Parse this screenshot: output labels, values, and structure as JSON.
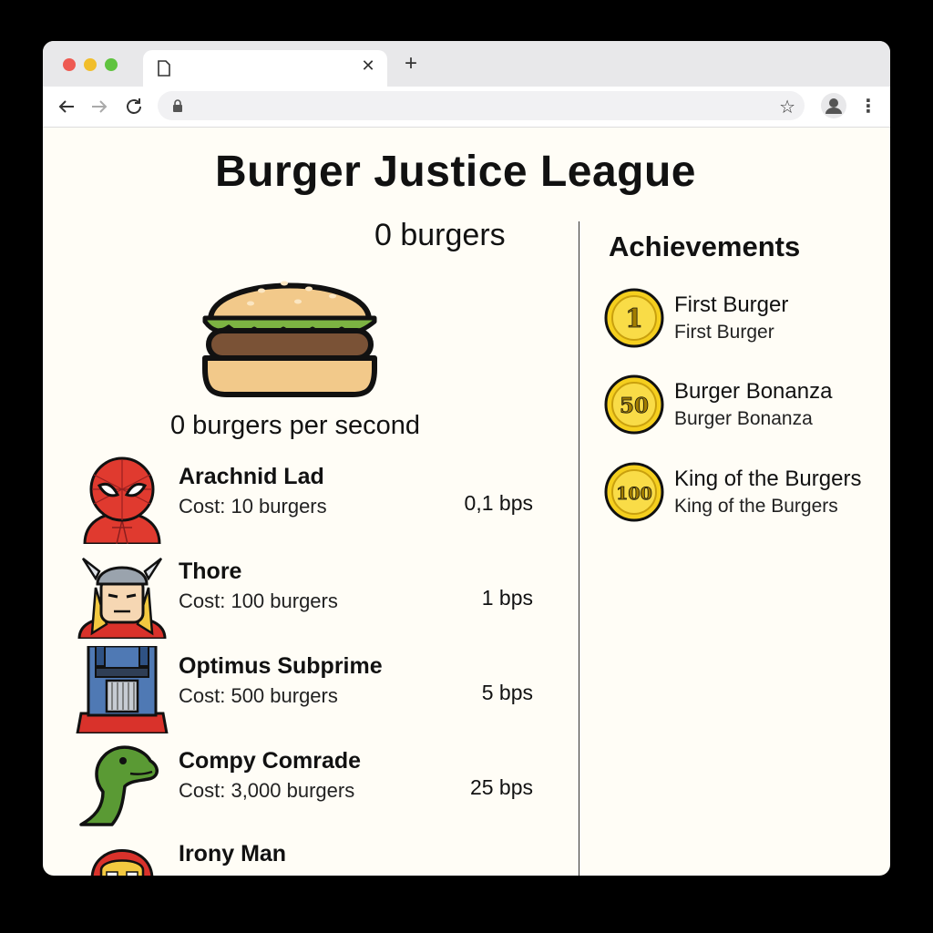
{
  "page": {
    "title": "Burger Justice League",
    "burger_count": "0 burgers",
    "burgers_per_second": "0 burgers per second"
  },
  "heroes": [
    {
      "name": "Arachnid Lad",
      "cost": "Cost: 10 burgers",
      "rate": "0,1 bps",
      "icon": "spider-hero-icon"
    },
    {
      "name": "Thore",
      "cost": "Cost: 100 burgers",
      "rate": "1 bps",
      "icon": "thunder-god-hero-icon"
    },
    {
      "name": "Optimus Subprime",
      "cost": "Cost: 500 burgers",
      "rate": "5 bps",
      "icon": "robot-hero-icon"
    },
    {
      "name": "Compy Comrade",
      "cost": "Cost: 3,000 burgers",
      "rate": "25 bps",
      "icon": "dinosaur-hero-icon"
    },
    {
      "name": "Irony Man",
      "icon": "armor-hero-icon"
    }
  ],
  "achievements": {
    "title": "Achievements",
    "items": [
      {
        "name": "First Burger",
        "desc": "First Burger",
        "coin": "1"
      },
      {
        "name": "Burger Bonanza",
        "desc": "Burger Bonanza",
        "coin": "50"
      },
      {
        "name": "King of the Burgers",
        "desc": "King of the Burgers",
        "coin": "100"
      }
    ]
  },
  "colors": {
    "background": "#fffdf6",
    "coin_gold": "#f5cf1e",
    "bun": "#f2c98a",
    "lettuce": "#7cb342",
    "patty": "#7a5236"
  }
}
